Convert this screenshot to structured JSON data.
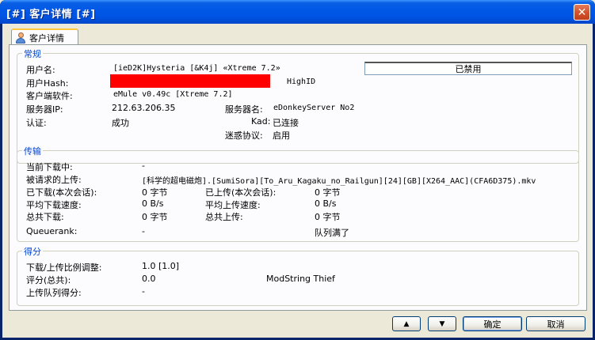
{
  "window": {
    "title": "[#] 客户详情 [#]"
  },
  "tab": {
    "label": "客户详情"
  },
  "general": {
    "title": "常规",
    "username_label": "用户名:",
    "username_value": "[ieD2K]Hysteria [&K4j] «Xtreme 7.2»",
    "status_value": "已禁用",
    "userhash_label": "用户Hash:",
    "userhash_type": "HighID",
    "client_label": "客户端软件:",
    "client_value": "eMule v0.49c [Xtreme 7.2]",
    "server_ip_label": "服务器IP:",
    "server_ip_value": "212.63.206.35",
    "server_name_label": "服务器名:",
    "server_name_value": "eDonkeyServer No2",
    "auth_label": "认证:",
    "auth_value": "成功",
    "kad_label": "Kad:",
    "kad_value": "已连接",
    "obfusc_label": "迷惑协议:",
    "obfusc_value": "启用"
  },
  "transfer": {
    "title": "传输",
    "current_dl_label": "当前下载中:",
    "current_dl_value": "-",
    "requested_label": "被请求的上传:",
    "requested_value": "[科学的超电磁炮].[SumiSora][To_Aru_Kagaku_no_Railgun][24][GB][X264_AAC](CFA6D375).mkv",
    "downloaded_label": "已下载(本次会话):",
    "downloaded_value": "0 字节",
    "uploaded_label": "已上传(本次会话):",
    "uploaded_value": "0 字节",
    "avg_dl_label": "平均下载速度:",
    "avg_dl_value": "0 B/s",
    "avg_ul_label": "平均上传速度:",
    "avg_ul_value": "0 B/s",
    "total_dl_label": "总共下载:",
    "total_dl_value": "0 字节",
    "total_ul_label": "总共上传:",
    "total_ul_value": "0 字节",
    "queuerank_label": "Queuerank:",
    "queuerank_value": "-",
    "queue_status": "队列满了"
  },
  "score": {
    "title": "得分",
    "ratio_label": "下载/上传比例调整:",
    "ratio_value": "1.0 [1.0]",
    "rating_label": "评分(总共):",
    "rating_value": "0.0",
    "modstring": "ModString Thief",
    "queue_score_label": "上传队列得分:",
    "queue_score_value": "-"
  },
  "buttons": {
    "up": "▲",
    "down": "▼",
    "ok": "确定",
    "cancel": "取消"
  },
  "colors": {
    "title_blue": "#0054e3",
    "group_title": "#0046d5",
    "redacted": "#ff0000"
  }
}
